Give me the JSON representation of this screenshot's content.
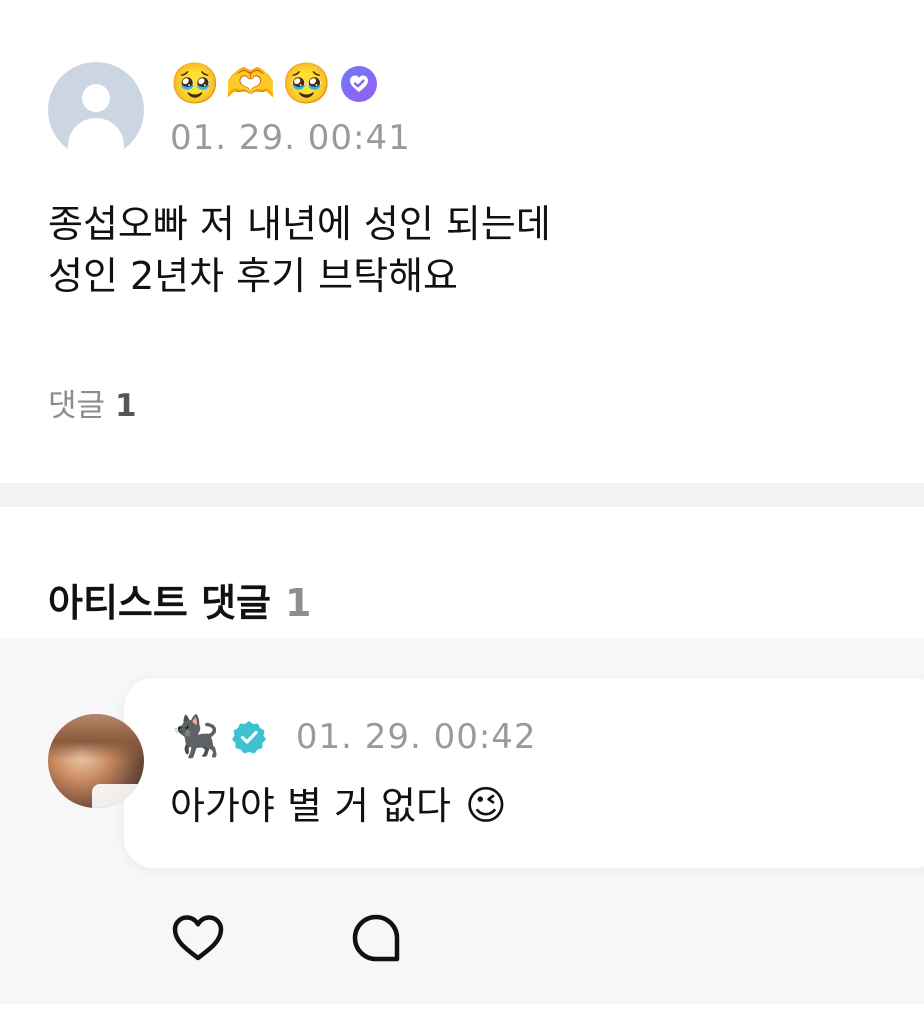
{
  "post": {
    "nickname_emojis": [
      "🥹",
      "🫶",
      "🥹"
    ],
    "time": "01. 29. 00:41",
    "body_lines": [
      "종섭오빠 저 내년에 성인 되는데",
      "성인 2년차 후기 브탁해요"
    ],
    "comment_label": "댓글",
    "comment_count": "1"
  },
  "artist_section": {
    "title": "아티스트 댓글",
    "count": "1"
  },
  "artist_comment": {
    "nickname_emoji": "🐈‍⬛",
    "time": "01. 29. 00:42",
    "text": "아가야 별 거 없다",
    "trailing_emoji": "😉"
  },
  "colors": {
    "badge_gradient_start": "#6a7cf7",
    "badge_gradient_end": "#9b5cf2",
    "artist_badge": "#3cc3cf",
    "muted_text": "#9a9a9a",
    "divider": "#f2f2f4",
    "artist_bg": "#f7f7f9"
  },
  "icons": {
    "fan_badge": "heart-check-badge-icon",
    "artist_badge": "verified-check-icon",
    "like": "heart-icon",
    "reply": "speech-bubble-icon"
  }
}
